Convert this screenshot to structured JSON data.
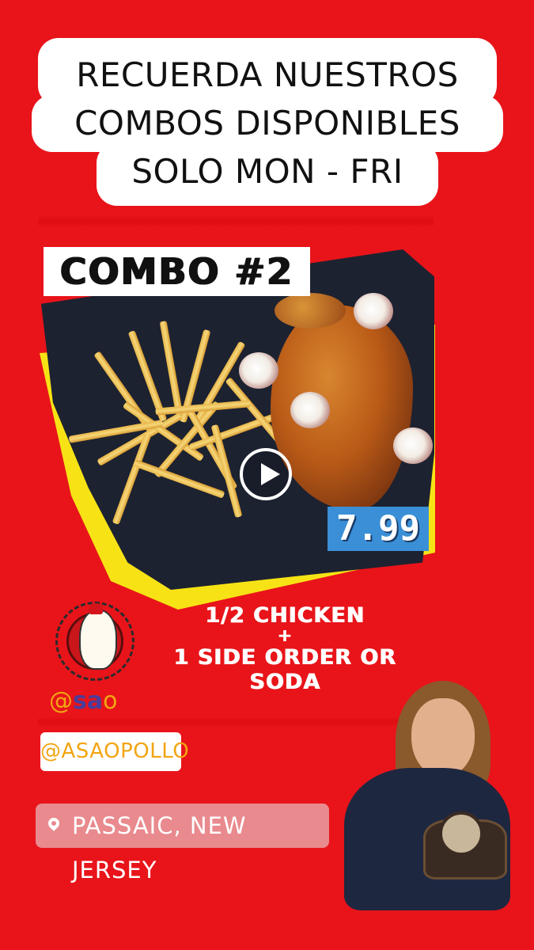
{
  "headline": {
    "line1": "RECUERDA NUESTROS",
    "line2": "COMBOS DISPONIBLES",
    "line3": "SOLO MON - FRI"
  },
  "combo": {
    "label": "COMBO #2",
    "price": "7.99"
  },
  "offer": {
    "line1": "1/2 CHICKEN",
    "plus": "+",
    "line2": "1 SIDE ORDER OR SODA"
  },
  "brand": {
    "at": "@",
    "sa": "sa",
    "o": "o",
    "handle": "@ASAOPOLLO"
  },
  "location": {
    "icon": "location-pin-icon",
    "text": "PASSAIC, NEW JERSEY"
  },
  "colors": {
    "background": "#e8141a",
    "accent_yellow": "#f7e315",
    "price_blue": "#3a8fd6",
    "location_pink": "#e98a8e",
    "handle_orange": "#f2a512"
  }
}
